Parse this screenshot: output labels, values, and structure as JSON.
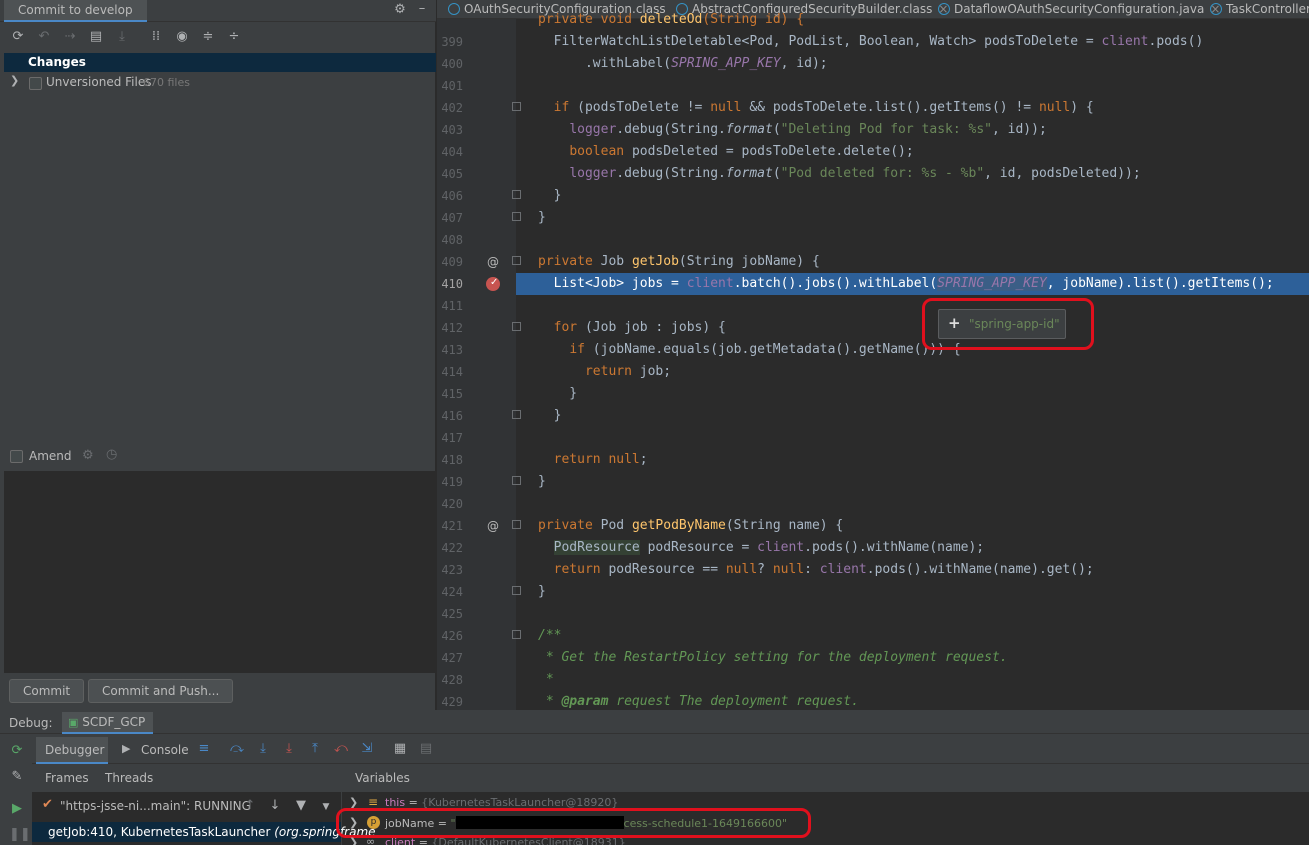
{
  "commit_panel": {
    "title": "Commit to develop",
    "changes_label": "Changes",
    "unversioned_label": "Unversioned Files",
    "unversioned_count": "670 files",
    "amend_label": "Amend",
    "commit_label": "Commit",
    "commit_push_label": "Commit and Push..."
  },
  "tabs": [
    {
      "label": "OAuthSecurityConfiguration.class"
    },
    {
      "label": "AbstractConfiguredSecurityBuilder.class"
    },
    {
      "label": "DataflowOAuthSecurityConfiguration.java"
    },
    {
      "label": "TaskControllerI"
    }
  ],
  "line_numbers": [
    "399",
    "400",
    "401",
    "402",
    "403",
    "404",
    "405",
    "406",
    "407",
    "408",
    "409",
    "410",
    "411",
    "412",
    "413",
    "414",
    "415",
    "416",
    "417",
    "418",
    "419",
    "420",
    "421",
    "422",
    "423",
    "424",
    "425",
    "426",
    "427",
    "428",
    "429"
  ],
  "tooltip": {
    "value": "\"spring-app-id\""
  },
  "debug": {
    "title": "Debug:",
    "config_name": "SCDF_GCP",
    "tab_debugger": "Debugger",
    "tab_console": "Console",
    "frames_label": "Frames",
    "threads_label": "Threads",
    "variables_label": "Variables",
    "thread_status": "\"https-jsse-ni...main\": RUNNING",
    "frame_entry": "getJob:410, KubernetesTaskLauncher",
    "frame_pkg": "(org.springframe",
    "vars": [
      {
        "name": "this",
        "value": "{KubernetesTaskLauncher@18920}"
      },
      {
        "name": "jobName",
        "value": "\"",
        "value_suffix": "cess-schedule1-1649166600\""
      },
      {
        "name": "client",
        "value": "{DefaultKubernetesClient@18931}"
      }
    ]
  }
}
